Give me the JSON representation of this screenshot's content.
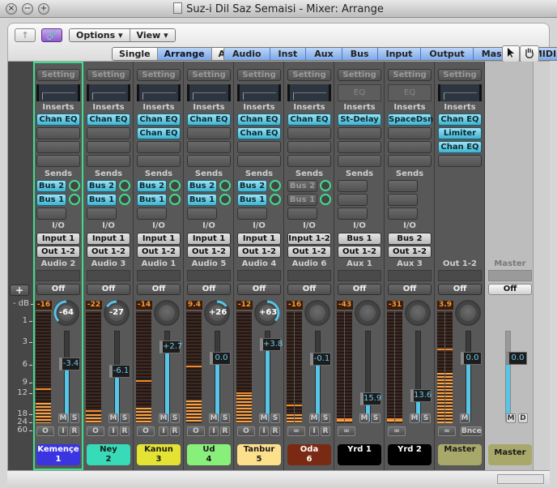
{
  "window": {
    "title": "Suz-i Dil Saz Semaisi - Mixer: Arrange",
    "controls": [
      "close",
      "minimize",
      "zoom"
    ]
  },
  "toolbar": {
    "up_label": "↑",
    "link_label": "🔗",
    "options_label": "Options ▾",
    "view_label": "View ▾",
    "view_modes": [
      {
        "label": "Single",
        "active": false
      },
      {
        "label": "Arrange",
        "active": true
      },
      {
        "label": "All",
        "active": false
      }
    ],
    "filters": [
      "Audio",
      "Inst",
      "Aux",
      "Bus",
      "Input",
      "Output",
      "Master",
      "MIDI"
    ],
    "pointer_tool": "pointer-icon",
    "hand_tool": "hand-icon"
  },
  "labels": {
    "setting": "Setting",
    "inserts": "Inserts",
    "sends": "Sends",
    "io": "I/O",
    "off": "Off",
    "eq": "EQ",
    "add": "+"
  },
  "scale": {
    "unit": "- dB",
    "ticks": [
      "1",
      "3",
      "6",
      "9",
      "12",
      "18",
      "24",
      "60"
    ]
  },
  "accent_colors": {
    "selected_outline": "#3fdc8e",
    "insert_button": "#5ec3dc",
    "fader_fill": "#56c5e8",
    "meter_peak": "#f39b3a"
  },
  "strips": [
    {
      "name": "Kemençe",
      "number": "1",
      "color": "#3a35e0",
      "text_color": "#ffffff",
      "selected": true,
      "eq": "thumb",
      "inserts": [
        "Chan EQ"
      ],
      "sends": [
        {
          "label": "Bus 2",
          "active": true
        },
        {
          "label": "Bus 1",
          "active": true
        }
      ],
      "input": "Input 1",
      "output": "Out 1-2",
      "io_label": "Audio 2",
      "peak": "-16",
      "pan": "-64",
      "pan_value": -64,
      "volume": "-3.4",
      "volume_level": 0.63,
      "meter_level": 0.18,
      "meter_hold": 0.3,
      "stereo": false,
      "buttons_top": [
        "M",
        "S"
      ],
      "buttons_bottom": [
        "O",
        "I",
        "R"
      ]
    },
    {
      "name": "Ney",
      "number": "2",
      "color": "#37dbb8",
      "text_color": "#1a1a1a",
      "selected": false,
      "eq": "thumb",
      "inserts": [
        "Chan EQ"
      ],
      "sends": [
        {
          "label": "Bus 2",
          "active": true
        },
        {
          "label": "Bus 1",
          "active": true
        }
      ],
      "input": "Input 1",
      "output": "Out 1-2",
      "io_label": "Audio 3",
      "peak": "-22",
      "pan": "-27",
      "pan_value": -27,
      "volume": "-6.1",
      "volume_level": 0.55,
      "meter_level": 0.08,
      "meter_hold": 0.1,
      "stereo": false,
      "buttons_top": [
        "M",
        "S"
      ],
      "buttons_bottom": [
        "O",
        "I",
        "R"
      ]
    },
    {
      "name": "Kanun",
      "number": "3",
      "color": "#e4e334",
      "text_color": "#1a1a1a",
      "selected": false,
      "eq": "thumb",
      "inserts": [
        "Chan EQ",
        "Chan EQ"
      ],
      "sends": [
        {
          "label": "Bus 2",
          "active": true
        },
        {
          "label": "Bus 1",
          "active": true
        }
      ],
      "input": "Input 1",
      "output": "Out 1-2",
      "io_label": "Audio 1",
      "peak": "-14",
      "pan": "",
      "pan_value": 0,
      "volume": "+2.7",
      "volume_level": 0.82,
      "meter_level": 0.14,
      "meter_hold": 0.37,
      "stereo": false,
      "buttons_top": [
        "M",
        "S"
      ],
      "buttons_bottom": [
        "O",
        "I",
        "R"
      ]
    },
    {
      "name": "Ud",
      "number": "4",
      "color": "#88f07a",
      "text_color": "#1a1a1a",
      "selected": false,
      "eq": "thumb",
      "inserts": [
        "Chan EQ"
      ],
      "sends": [
        {
          "label": "Bus 2",
          "active": true
        },
        {
          "label": "Bus 1",
          "active": true
        }
      ],
      "input": "Input 1",
      "output": "Out 1-2",
      "io_label": "Audio 5",
      "peak": "9.4",
      "pan": "+26",
      "pan_value": 26,
      "volume": "0.0",
      "volume_level": 0.7,
      "meter_level": 0.2,
      "meter_hold": 0.5,
      "stereo": false,
      "buttons_top": [
        "M",
        "S"
      ],
      "buttons_bottom": [
        "O",
        "I",
        "R"
      ]
    },
    {
      "name": "Tanbur",
      "number": "5",
      "color": "#fde08c",
      "text_color": "#1a1a1a",
      "selected": false,
      "eq": "thumb",
      "inserts": [
        "Chan EQ",
        "Chan EQ"
      ],
      "sends": [
        {
          "label": "Bus 2",
          "active": true
        },
        {
          "label": "Bus 1",
          "active": true
        }
      ],
      "input": "Input 1",
      "output": "Out 1-2",
      "io_label": "Audio 4",
      "peak": "-12",
      "pan": "+63",
      "pan_value": 63,
      "volume": "+3.8",
      "volume_level": 0.85,
      "meter_level": 0.25,
      "meter_hold": 0.26,
      "stereo": false,
      "buttons_top": [
        "M",
        "S"
      ],
      "buttons_bottom": [
        "O",
        "I",
        "R"
      ]
    },
    {
      "name": "Oda",
      "number": "6",
      "color": "#7a2a12",
      "text_color": "#ffffff",
      "selected": false,
      "eq": "thumb",
      "inserts": [
        "Chan EQ"
      ],
      "sends": [
        {
          "label": "Bus 2",
          "active": false
        },
        {
          "label": "Bus 1",
          "active": false
        }
      ],
      "input": "Input 1-2",
      "output": "Out 1-2",
      "io_label": "Audio 6",
      "peak": "-16",
      "pan": "",
      "pan_value": 0,
      "volume": "-0.1",
      "volume_level": 0.69,
      "meter_level": 0.08,
      "meter_hold": 0.15,
      "stereo": true,
      "buttons_top": [
        "M",
        "S"
      ],
      "buttons_bottom": [
        "∞",
        "I",
        "R"
      ]
    },
    {
      "name": "Yrd 1",
      "number": "",
      "color": "#000000",
      "text_color": "#ffffff",
      "selected": false,
      "eq": "box",
      "inserts": [
        "St-Delay"
      ],
      "sends": [],
      "input": "Bus 1",
      "output": "Out 1-2",
      "io_label": "Aux 1",
      "peak": "-43",
      "pan": "",
      "pan_value": 0,
      "volume": "15.9",
      "volume_level": 0.25,
      "meter_level": 0.03,
      "meter_hold": 0.03,
      "stereo": true,
      "buttons_top": [
        "M",
        "S"
      ],
      "buttons_bottom": [
        "∞"
      ]
    },
    {
      "name": "Yrd 2",
      "number": "",
      "color": "#000000",
      "text_color": "#ffffff",
      "selected": false,
      "eq": "box",
      "inserts": [
        "SpaceDsn"
      ],
      "sends": [],
      "input": "Bus 2",
      "output": "Out 1-2",
      "io_label": "Aux 3",
      "peak": "-31",
      "pan": "",
      "pan_value": 0,
      "volume": "13.6",
      "volume_level": 0.29,
      "meter_level": 0.03,
      "meter_hold": 0.03,
      "stereo": true,
      "buttons_top": [
        "M",
        "S"
      ],
      "buttons_bottom": [
        "∞"
      ]
    },
    {
      "name": "Master",
      "number": "",
      "color": "#a8a86a",
      "text_color": "#1a1a1a",
      "selected": false,
      "eq": "thumb",
      "inserts": [
        "Chan EQ",
        "Limiter",
        "Chan EQ"
      ],
      "sends": null,
      "input": null,
      "output": null,
      "io_label": "Out 1-2",
      "peak": "3.9",
      "pan": "",
      "pan_value": 0,
      "volume": "0.0",
      "volume_level": 0.7,
      "meter_level": 0.45,
      "meter_hold": 0.65,
      "stereo": true,
      "buttons_top": [
        "M"
      ],
      "buttons_bottom": [
        "∞",
        "Bnce"
      ]
    },
    {
      "name": "Master",
      "number": "",
      "color": "#a8a86a",
      "text_color": "#1a1a1a",
      "selected": false,
      "master": true,
      "io_label": "Master",
      "volume": "0.0",
      "volume_level": 0.7,
      "buttons_top": [
        "M",
        "D"
      ]
    }
  ]
}
